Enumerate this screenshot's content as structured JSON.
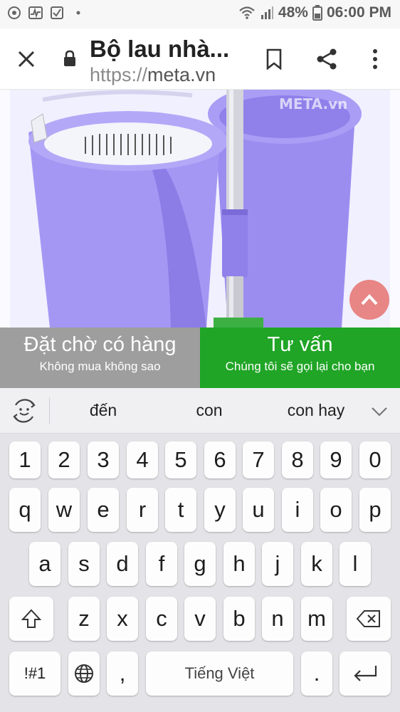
{
  "status_bar": {
    "battery": "48%",
    "time": "06:00 PM",
    "left_icons": [
      "whatsapp-icon",
      "activity-icon",
      "checkbox-icon",
      "dot-icon"
    ],
    "right_icons": [
      "wifi-icon",
      "signal-icon",
      "battery-icon"
    ]
  },
  "browser": {
    "page_title": "Bộ lau nhà...",
    "url_scheme": "https://",
    "url_host": "meta.vn"
  },
  "product_image": {
    "watermark": "META.vn",
    "colors": {
      "bucket": "#9a8cf0",
      "bucket_dark": "#7d6de0",
      "handle": "#c9c9d2"
    }
  },
  "actions": {
    "wait": {
      "title": "Đặt chờ có hàng",
      "subtitle": "Không mua không sao",
      "color": "#9e9e9e"
    },
    "consult": {
      "title": "Tư vấn",
      "subtitle": "Chúng tôi sẽ gọi lại cho bạn",
      "color": "#20a526"
    }
  },
  "suggestions": [
    "đến",
    "con",
    "con hay"
  ],
  "keyboard": {
    "row1": [
      "1",
      "2",
      "3",
      "4",
      "5",
      "6",
      "7",
      "8",
      "9",
      "0"
    ],
    "row2": [
      "q",
      "w",
      "e",
      "r",
      "t",
      "y",
      "u",
      "i",
      "o",
      "p"
    ],
    "row3": [
      "a",
      "s",
      "d",
      "f",
      "g",
      "h",
      "j",
      "k",
      "l"
    ],
    "row4": [
      "z",
      "x",
      "c",
      "v",
      "b",
      "n",
      "m"
    ],
    "symbols_label": "!#1",
    "comma": ",",
    "space_label": "Tiếng Việt",
    "period": "."
  }
}
